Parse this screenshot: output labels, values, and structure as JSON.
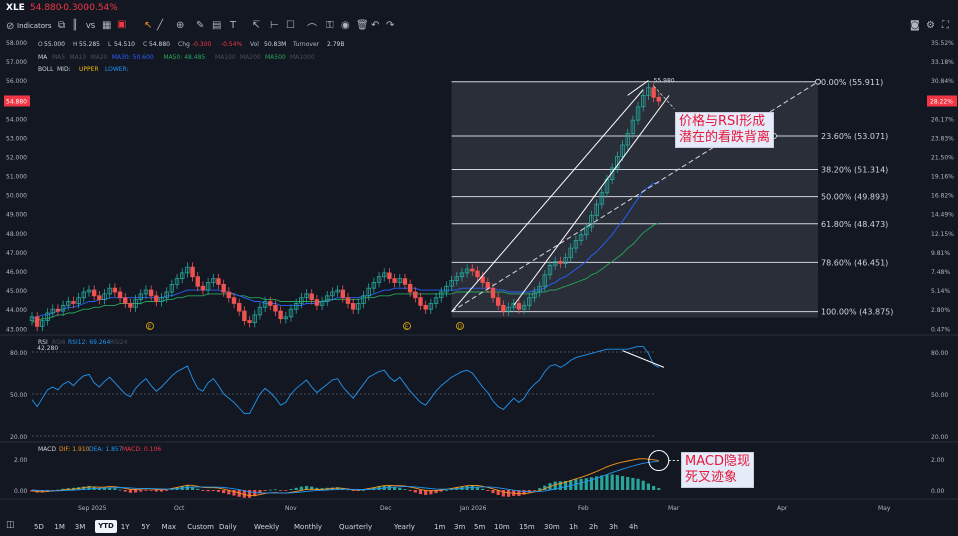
{
  "header": {
    "symbol": "XLE",
    "price": "54.880",
    "change": "-0.300",
    "change_pct": "-0.54%"
  },
  "toolbar": {
    "indicators_label": "Indicators",
    "vs_label": "VS"
  },
  "legend": {
    "ohlc": [
      [
        "O",
        "55.000"
      ],
      [
        "H",
        "55.285"
      ],
      [
        "L",
        "54.510"
      ],
      [
        "C",
        "54.880"
      ],
      [
        "Chg",
        "-0.300"
      ],
      [
        "",
        "-0.54%"
      ],
      [
        "Vol",
        "50.83M"
      ],
      [
        "Turnover",
        "2.79B"
      ]
    ],
    "ma_label": "MA",
    "ma_items": [
      {
        "t": "MA5",
        "c": "#4a4f5a"
      },
      {
        "t": "MA10",
        "c": "#4a4f5a"
      },
      {
        "t": "MA20",
        "c": "#4a4f5a"
      },
      {
        "t": "MA30: 50.600",
        "c": "#2962ff"
      },
      {
        "t": "MA50: 48.485",
        "c": "#26a65b"
      },
      {
        "t": "MA100",
        "c": "#4a4f5a"
      },
      {
        "t": "MA200",
        "c": "#4a4f5a"
      },
      {
        "t": "MA500",
        "c": "#26a65b"
      },
      {
        "t": "MA1000",
        "c": "#4a4f5a"
      }
    ],
    "boll_label": "BOLL",
    "boll_items": [
      {
        "t": "MID:",
        "c": "#d1d4dc"
      },
      {
        "t": "UPPER",
        "c": "#f0b90b"
      },
      {
        "t": "LOWER:",
        "c": "#2196f3"
      }
    ]
  },
  "price_axis": {
    "labels": [
      "58.000",
      "57.000",
      "56.000",
      "55.000",
      "54.000",
      "53.000",
      "52.000",
      "51.000",
      "50.000",
      "49.000",
      "48.000",
      "47.000",
      "46.000",
      "45.000",
      "44.000",
      "43.000"
    ],
    "current": "54.880"
  },
  "pct_axis": {
    "labels": [
      "35.52%",
      "33.18%",
      "30.84%",
      "28.50%",
      "26.17%",
      "23.83%",
      "21.50%",
      "19.16%",
      "16.82%",
      "14.49%",
      "12.15%",
      "9.81%",
      "7.48%",
      "5.14%",
      "2.80%",
      "0.47%"
    ],
    "current": "28.22%"
  },
  "fib": [
    {
      "label": "0.00% (55.911)",
      "v": 55.911
    },
    {
      "label": "23.60% (53.071)",
      "v": 53.071
    },
    {
      "label": "38.20% (51.314)",
      "v": 51.314
    },
    {
      "label": "50.00% (49.893)",
      "v": 49.893
    },
    {
      "label": "61.80% (48.473)",
      "v": 48.473
    },
    {
      "label": "78.60% (46.451)",
      "v": 46.451
    },
    {
      "label": "100.00% (43.875)",
      "v": 43.875
    }
  ],
  "high_label": "55.980",
  "low_label": "42.280",
  "events": [
    "E",
    "E",
    "D"
  ],
  "rsi": {
    "label": "RSI",
    "rsi6": "RSI6",
    "rsi12": "RSI12: 69.264",
    "rsi24": "RSI24",
    "axis": [
      "80.00",
      "50.00",
      "20.00"
    ]
  },
  "macd": {
    "label": "MACD",
    "dif": "DIF: 1.910",
    "dea": "DEA: 1.857",
    "macd": "MACD: 0.106",
    "axis": [
      "2.00",
      "0.00"
    ]
  },
  "x_axis": [
    "Sep 2025",
    "Oct",
    "Nov",
    "Dec",
    "Jan 2026",
    "Feb",
    "Mar",
    "Apr",
    "May"
  ],
  "annotations": {
    "rsi_div": "价格与RSI形成\n潜在的看跌背离",
    "macd_cross": "MACD隐现\n死叉迹象"
  },
  "bottom": {
    "ranges": [
      "5D",
      "1M",
      "3M",
      "YTD",
      "1Y",
      "5Y",
      "Max",
      "Custom"
    ],
    "active": "YTD",
    "intervals": [
      "Daily",
      "Weekly",
      "Monthly",
      "Quarterly",
      "Yearly",
      "1m",
      "3m",
      "5m",
      "10m",
      "15m",
      "30m",
      "1h",
      "2h",
      "3h",
      "4h"
    ]
  },
  "colors": {
    "up": "#26a69a",
    "down": "#ef5350",
    "accent": "#f23645",
    "ma30": "#2962ff",
    "ma50": "#26a65b",
    "dif": "#f7931a",
    "dea": "#2196f3",
    "rsi": "#2196f3"
  },
  "chart_data": {
    "type": "candlestick",
    "closes": [
      43.6,
      43.1,
      43.4,
      43.8,
      44.0,
      43.9,
      44.2,
      44.4,
      44.3,
      44.6,
      44.9,
      45.0,
      44.7,
      44.5,
      44.8,
      45.1,
      44.9,
      44.6,
      44.3,
      44.1,
      44.5,
      44.8,
      45.0,
      44.7,
      44.4,
      44.6,
      44.9,
      45.3,
      45.6,
      45.9,
      46.2,
      45.7,
      45.2,
      45.0,
      45.4,
      45.6,
      45.3,
      44.9,
      44.6,
      44.3,
      43.9,
      43.4,
      43.3,
      43.7,
      44.1,
      44.4,
      44.2,
      43.9,
      43.5,
      43.6,
      44.0,
      44.3,
      44.6,
      44.8,
      44.5,
      44.2,
      44.4,
      44.7,
      44.9,
      45.0,
      44.6,
      44.3,
      44.0,
      44.3,
      44.7,
      45.1,
      45.4,
      45.7,
      45.9,
      45.6,
      45.4,
      45.6,
      45.3,
      44.9,
      44.6,
      44.2,
      44.0,
      44.3,
      44.6,
      44.9,
      45.2,
      45.5,
      45.7,
      45.9,
      46.1,
      46.0,
      45.7,
      45.4,
      45.1,
      44.6,
      44.2,
      43.9,
      44.1,
      44.3,
      44.0,
      44.2,
      44.6,
      44.9,
      45.2,
      45.8,
      46.3,
      46.5,
      46.4,
      46.7,
      47.2,
      47.6,
      47.9,
      48.3,
      48.9,
      49.5,
      50.1,
      50.8,
      51.4,
      52.0,
      52.6,
      53.2,
      53.9,
      54.6,
      55.2,
      55.6,
      55.1,
      54.9
    ],
    "ma30": [
      43.5,
      43.6,
      43.7,
      43.7,
      43.8,
      43.9,
      44.0,
      44.1,
      44.1,
      44.2,
      44.3,
      44.4,
      44.4,
      44.5,
      44.5,
      44.6,
      44.6,
      44.6,
      44.6,
      44.6,
      44.6,
      44.6,
      44.6,
      44.6,
      44.6,
      44.6,
      44.7,
      44.7,
      44.8,
      44.9,
      45.0,
      45.0,
      45.0,
      45.0,
      45.0,
      45.0,
      45.0,
      44.9,
      44.9,
      44.8,
      44.7,
      44.6,
      44.5,
      44.4,
      44.4,
      44.3,
      44.3,
      44.3,
      44.2,
      44.2,
      44.2,
      44.2,
      44.2,
      44.3,
      44.3,
      44.3,
      44.4,
      44.4,
      44.5,
      44.6,
      44.6,
      44.6,
      44.6,
      44.6,
      44.7,
      44.7,
      44.8,
      44.9,
      45.0,
      45.0,
      45.1,
      45.1,
      45.1,
      45.1,
      45.1,
      45.0,
      45.0,
      45.0,
      45.0,
      45.0,
      45.0,
      45.0,
      45.0,
      45.1,
      45.1,
      45.1,
      45.1,
      45.1,
      45.1,
      45.1,
      45.0,
      45.0,
      44.9,
      44.9,
      44.9,
      44.9,
      44.9,
      45.0,
      45.0,
      45.1,
      45.3,
      45.4,
      45.6,
      45.7,
      45.9,
      46.1,
      46.3,
      46.5,
      46.8,
      47.0,
      47.3,
      47.6,
      47.9,
      48.3,
      48.6,
      49.0,
      49.4,
      49.8,
      50.2,
      50.4,
      50.6,
      50.6
    ],
    "ma50": [
      43.3,
      43.4,
      43.5,
      43.5,
      43.6,
      43.7,
      43.7,
      43.8,
      43.8,
      43.9,
      44.0,
      44.0,
      44.1,
      44.1,
      44.2,
      44.2,
      44.2,
      44.3,
      44.3,
      44.3,
      44.3,
      44.3,
      44.4,
      44.4,
      44.4,
      44.4,
      44.5,
      44.5,
      44.6,
      44.6,
      44.7,
      44.7,
      44.7,
      44.7,
      44.8,
      44.8,
      44.8,
      44.8,
      44.8,
      44.8,
      44.7,
      44.7,
      44.6,
      44.6,
      44.6,
      44.5,
      44.5,
      44.5,
      44.4,
      44.4,
      44.4,
      44.4,
      44.4,
      44.4,
      44.4,
      44.4,
      44.4,
      44.5,
      44.5,
      44.5,
      44.5,
      44.5,
      44.5,
      44.5,
      44.6,
      44.6,
      44.6,
      44.7,
      44.7,
      44.7,
      44.8,
      44.8,
      44.8,
      44.8,
      44.8,
      44.8,
      44.8,
      44.8,
      44.8,
      44.8,
      44.8,
      44.8,
      44.9,
      44.9,
      44.9,
      44.9,
      44.9,
      44.9,
      44.9,
      44.9,
      44.9,
      44.9,
      44.8,
      44.8,
      44.8,
      44.8,
      44.8,
      44.8,
      44.9,
      44.9,
      45.0,
      45.0,
      45.1,
      45.2,
      45.3,
      45.4,
      45.5,
      45.6,
      45.8,
      45.9,
      46.1,
      46.3,
      46.5,
      46.7,
      46.9,
      47.2,
      47.4,
      47.7,
      48.0,
      48.2,
      48.4,
      48.5
    ],
    "rsi12": [
      46,
      41,
      47,
      53,
      55,
      53,
      57,
      59,
      56,
      60,
      63,
      64,
      58,
      55,
      59,
      62,
      58,
      54,
      50,
      48,
      54,
      58,
      61,
      56,
      52,
      55,
      59,
      63,
      66,
      68,
      70,
      61,
      54,
      52,
      58,
      61,
      56,
      50,
      47,
      44,
      40,
      36,
      36,
      43,
      50,
      54,
      51,
      47,
      42,
      44,
      50,
      54,
      57,
      60,
      55,
      51,
      54,
      57,
      60,
      61,
      55,
      51,
      47,
      52,
      57,
      62,
      64,
      66,
      67,
      62,
      59,
      62,
      57,
      52,
      48,
      44,
      42,
      47,
      52,
      56,
      59,
      62,
      64,
      66,
      67,
      65,
      60,
      55,
      51,
      45,
      41,
      39,
      43,
      47,
      44,
      47,
      53,
      57,
      60,
      66,
      70,
      71,
      69,
      71,
      74,
      76,
      77,
      78,
      79,
      80,
      81,
      82,
      82,
      82,
      82,
      82,
      83,
      84,
      84,
      79,
      71,
      69
    ],
    "macd_dif": [
      -0.05,
      -0.1,
      -0.12,
      -0.1,
      -0.06,
      -0.04,
      0.0,
      0.04,
      0.06,
      0.1,
      0.15,
      0.2,
      0.2,
      0.18,
      0.19,
      0.22,
      0.21,
      0.17,
      0.1,
      0.04,
      0.03,
      0.05,
      0.08,
      0.07,
      0.03,
      0.02,
      0.04,
      0.1,
      0.17,
      0.24,
      0.31,
      0.3,
      0.24,
      0.17,
      0.15,
      0.16,
      0.12,
      0.06,
      -0.02,
      -0.1,
      -0.2,
      -0.3,
      -0.36,
      -0.36,
      -0.3,
      -0.22,
      -0.18,
      -0.17,
      -0.2,
      -0.2,
      -0.15,
      -0.09,
      -0.02,
      0.04,
      0.05,
      0.03,
      0.04,
      0.07,
      0.1,
      0.13,
      0.11,
      0.07,
      0.01,
      0.0,
      0.03,
      0.09,
      0.15,
      0.22,
      0.28,
      0.29,
      0.28,
      0.28,
      0.25,
      0.19,
      0.12,
      0.04,
      -0.03,
      -0.05,
      -0.04,
      0.0,
      0.05,
      0.1,
      0.16,
      0.22,
      0.28,
      0.3,
      0.29,
      0.24,
      0.17,
      0.08,
      -0.02,
      -0.12,
      -0.18,
      -0.2,
      -0.24,
      -0.24,
      -0.19,
      -0.12,
      -0.04,
      0.08,
      0.22,
      0.34,
      0.42,
      0.5,
      0.61,
      0.72,
      0.82,
      0.93,
      1.06,
      1.2,
      1.35,
      1.5,
      1.62,
      1.72,
      1.8,
      1.87,
      1.94,
      2.0,
      2.02,
      1.99,
      1.95,
      1.91
    ],
    "macd_dea": [
      0.0,
      -0.02,
      -0.04,
      -0.05,
      -0.05,
      -0.05,
      -0.04,
      -0.02,
      -0.01,
      0.01,
      0.04,
      0.07,
      0.09,
      0.11,
      0.12,
      0.14,
      0.15,
      0.16,
      0.15,
      0.13,
      0.11,
      0.1,
      0.1,
      0.09,
      0.08,
      0.07,
      0.06,
      0.07,
      0.09,
      0.12,
      0.16,
      0.19,
      0.2,
      0.2,
      0.19,
      0.19,
      0.18,
      0.16,
      0.12,
      0.08,
      0.02,
      -0.05,
      -0.11,
      -0.16,
      -0.19,
      -0.19,
      -0.19,
      -0.19,
      -0.19,
      -0.19,
      -0.18,
      -0.16,
      -0.13,
      -0.09,
      -0.06,
      -0.04,
      -0.02,
      0.0,
      0.02,
      0.04,
      0.05,
      0.05,
      0.04,
      0.03,
      0.03,
      0.04,
      0.06,
      0.09,
      0.13,
      0.16,
      0.19,
      0.21,
      0.22,
      0.22,
      0.2,
      0.17,
      0.13,
      0.09,
      0.06,
      0.05,
      0.05,
      0.06,
      0.08,
      0.11,
      0.14,
      0.17,
      0.19,
      0.2,
      0.2,
      0.18,
      0.14,
      0.09,
      0.04,
      -0.01,
      -0.05,
      -0.09,
      -0.11,
      -0.11,
      -0.1,
      -0.06,
      0.0,
      0.07,
      0.14,
      0.21,
      0.29,
      0.37,
      0.46,
      0.55,
      0.65,
      0.76,
      0.88,
      1.0,
      1.12,
      1.24,
      1.35,
      1.45,
      1.55,
      1.64,
      1.72,
      1.78,
      1.82,
      1.85
    ]
  }
}
